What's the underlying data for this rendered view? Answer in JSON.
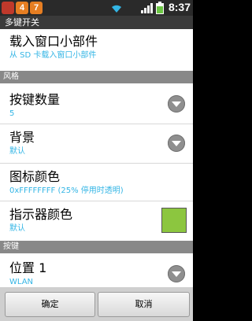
{
  "status": {
    "time": "8:37",
    "badge_a": "4",
    "badge_b": "7"
  },
  "title": "多键开关",
  "load_widget": {
    "title": "载入窗口小部件",
    "subtitle": "从 SD 卡载入窗口小部件"
  },
  "style_header": "风格",
  "key_count": {
    "title": "按键数量",
    "value": "5"
  },
  "background": {
    "title": "背景",
    "value": "默认"
  },
  "icon_color": {
    "title": "图标颜色",
    "value": "0xFFFFFFFF (25% 停用时透明)"
  },
  "indicator_color": {
    "title": "指示器颜色",
    "value": "默认",
    "swatch": "#8cc63f"
  },
  "keys_header": "按键",
  "position1": {
    "title": "位置 1",
    "value": "WLAN"
  },
  "buttons": {
    "ok": "确定",
    "cancel": "取消"
  }
}
